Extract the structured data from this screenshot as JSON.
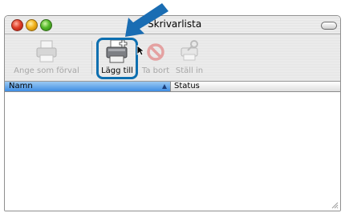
{
  "window": {
    "title": "Skrivarlista"
  },
  "toolbar": {
    "items": [
      {
        "label": "Ange som förval",
        "enabled": false
      },
      {
        "label": "Lägg till",
        "enabled": true
      },
      {
        "label": "Ta bort",
        "enabled": false
      },
      {
        "label": "Ställ in",
        "enabled": false
      }
    ]
  },
  "table": {
    "columns": [
      "Namn",
      "Status"
    ],
    "sort_column": "Namn",
    "rows": []
  },
  "colors": {
    "highlight": "#0d6fb0",
    "header_selected": "#3f8ee3"
  }
}
